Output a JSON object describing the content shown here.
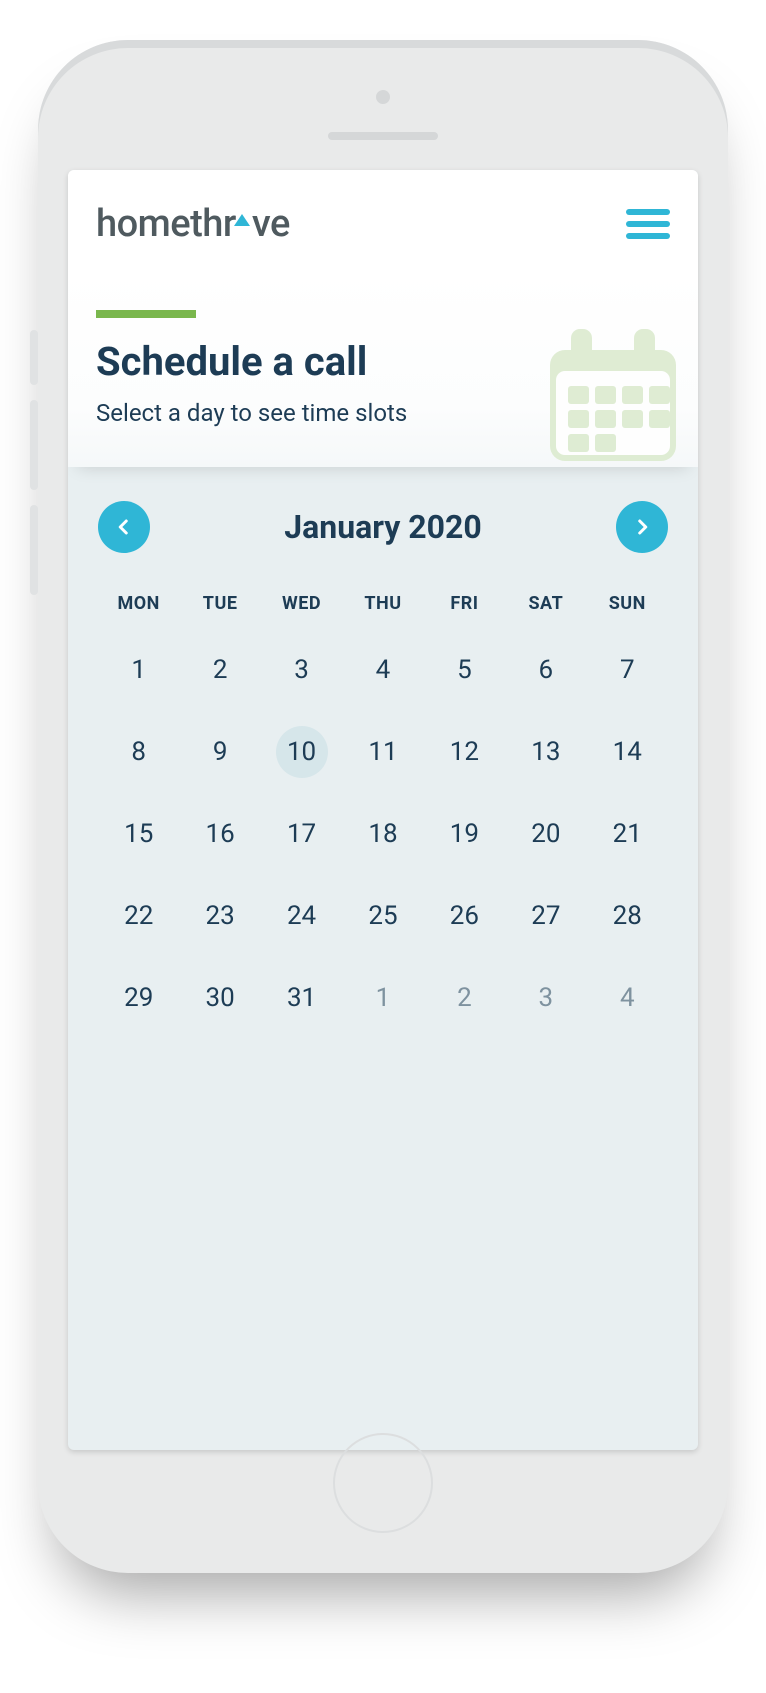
{
  "brand": {
    "name_left": "homethr",
    "name_right": "ve"
  },
  "hero": {
    "title": "Schedule a call",
    "subtitle": "Select a day to see time slots"
  },
  "calendar": {
    "month_label": "January 2020",
    "day_headers": [
      "MON",
      "TUE",
      "WED",
      "THU",
      "FRI",
      "SAT",
      "SUN"
    ],
    "selected_day": 10,
    "weeks": [
      [
        {
          "n": 1
        },
        {
          "n": 2
        },
        {
          "n": 3
        },
        {
          "n": 4
        },
        {
          "n": 5
        },
        {
          "n": 6
        },
        {
          "n": 7
        }
      ],
      [
        {
          "n": 8
        },
        {
          "n": 9
        },
        {
          "n": 10,
          "selected": true
        },
        {
          "n": 11
        },
        {
          "n": 12
        },
        {
          "n": 13
        },
        {
          "n": 14
        }
      ],
      [
        {
          "n": 15
        },
        {
          "n": 16
        },
        {
          "n": 17
        },
        {
          "n": 18
        },
        {
          "n": 19
        },
        {
          "n": 20
        },
        {
          "n": 21
        }
      ],
      [
        {
          "n": 22
        },
        {
          "n": 23
        },
        {
          "n": 24
        },
        {
          "n": 25
        },
        {
          "n": 26
        },
        {
          "n": 27
        },
        {
          "n": 28
        }
      ],
      [
        {
          "n": 29
        },
        {
          "n": 30
        },
        {
          "n": 31
        },
        {
          "n": 1,
          "outside": true
        },
        {
          "n": 2,
          "outside": true
        },
        {
          "n": 3,
          "outside": true
        },
        {
          "n": 4,
          "outside": true
        }
      ]
    ]
  },
  "colors": {
    "accent_teal": "#2fb6d6",
    "accent_green": "#7ab74d",
    "text_primary": "#1d3c55"
  }
}
